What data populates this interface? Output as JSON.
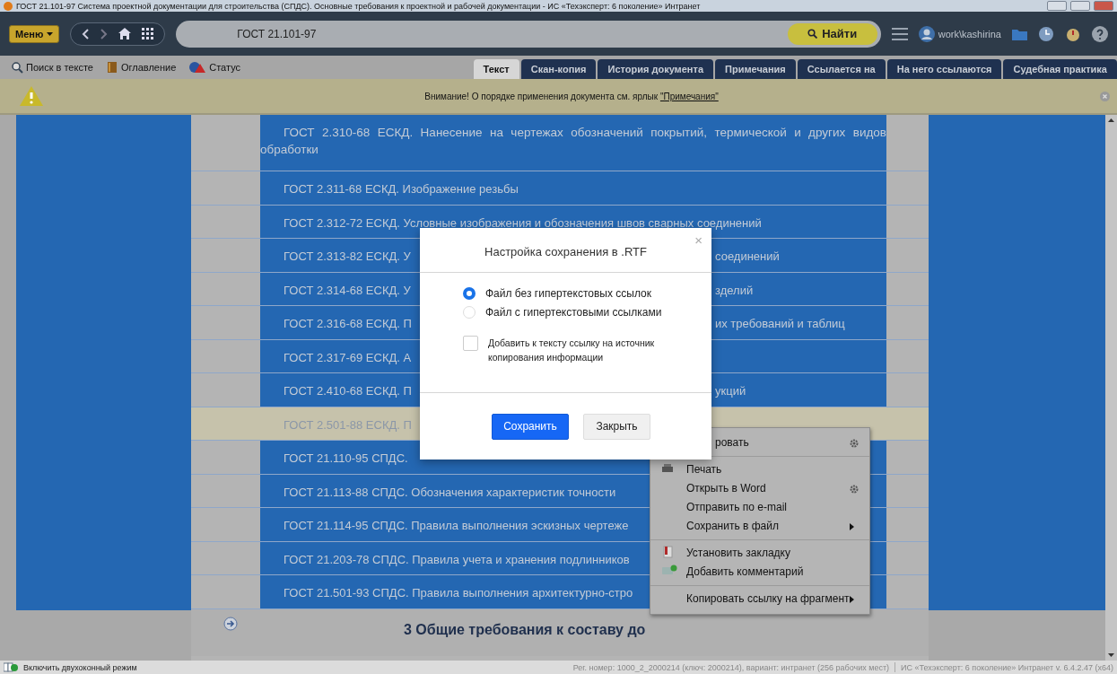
{
  "window": {
    "title": "ГОСТ 21.101-97 Система проектной документации для строительства (СПДС). Основные требования к проектной и рабочей документации - ИС «Техэксперт: 6 поколение» Интранет"
  },
  "toolbar": {
    "menu_button": "Меню",
    "search_value": "ГОСТ 21.101-97",
    "find_button": "Найти",
    "user": "work\\kashirina"
  },
  "secondary_toolbar": {
    "tools": [
      {
        "label": "Поиск в тексте"
      },
      {
        "label": "Оглавление"
      },
      {
        "label": "Статус"
      }
    ],
    "tabs": [
      {
        "label": "Текст",
        "selected": true
      },
      {
        "label": "Скан-копия",
        "selected": false
      },
      {
        "label": "История документа",
        "selected": false
      },
      {
        "label": "Примечания",
        "selected": false
      },
      {
        "label": "Ссылается на",
        "selected": false
      },
      {
        "label": "На него ссылаются",
        "selected": false
      },
      {
        "label": "Судебная практика",
        "selected": false
      }
    ]
  },
  "notice": {
    "text": "Внимание! О порядке применения документа см. ярлык ",
    "link": "\"Примечания\""
  },
  "document": {
    "rows": [
      {
        "text": "ГОСТ 2.310-68 ЕСКД. Нанесение на чертежах обозначений покрытий, термической и других видов обработки",
        "selected": false
      },
      {
        "text": "ГОСТ 2.311-68 ЕСКД. Изображение резьбы",
        "selected": false
      },
      {
        "text": "ГОСТ 2.312-72 ЕСКД. Условные изображения и обозначения швов сварных соединений",
        "selected": false
      },
      {
        "text": "ГОСТ 2.313-82 ЕСКД. У",
        "text_right": "соединений",
        "selected": false
      },
      {
        "text": "ГОСТ 2.314-68 ЕСКД. У",
        "text_right": "зделий",
        "selected": false
      },
      {
        "text": "ГОСТ 2.316-68 ЕСКД. П",
        "text_right": "их требований и таблиц",
        "selected": false
      },
      {
        "text": "ГОСТ 2.317-69 ЕСКД. А",
        "selected": false
      },
      {
        "text": "ГОСТ 2.410-68 ЕСКД. П",
        "text_right": "укций",
        "selected": false
      },
      {
        "text": "ГОСТ 2.501-88 ЕСКД. П",
        "selected": true
      },
      {
        "text": "ГОСТ 21.110-95 СПДС.",
        "selected": false
      },
      {
        "text": "ГОСТ 21.113-88 СПДС. Обозначения характеристик точности",
        "selected": false
      },
      {
        "text": "ГОСТ 21.114-95 СПДС. Правила выполнения эскизных чертеже",
        "selected": false
      },
      {
        "text": "ГОСТ 21.203-78 СПДС. Правила учета и хранения подлинников",
        "selected": false
      },
      {
        "text": "ГОСТ 21.501-93 СПДС. Правила выполнения архитектурно-стро",
        "selected": false
      }
    ],
    "section_heading": "3 Общие требования к составу до"
  },
  "context_menu": {
    "groups": [
      [
        {
          "label": "ровать"
        }
      ],
      [
        {
          "label": "Печать"
        },
        {
          "label": "Открыть в Word"
        },
        {
          "label": "Отправить по e-mail"
        },
        {
          "label": "Сохранить в файл"
        }
      ],
      [
        {
          "label": "Установить закладку"
        },
        {
          "label": "Добавить комментарий"
        }
      ],
      [
        {
          "label": "Копировать ссылку на фрагмент"
        }
      ]
    ]
  },
  "dialog": {
    "title": "Настройка сохранения в .RTF",
    "close": "×",
    "options": [
      {
        "label": "Файл без гипертекстовых ссылок",
        "selected": true
      },
      {
        "label": "Файл с гипертекстовыми ссылками",
        "selected": false
      }
    ],
    "checkbox": {
      "label": "Добавить к тексту ссылку на источник копирования информации",
      "checked": false
    },
    "buttons": [
      {
        "label": "Сохранить",
        "kind": "primary"
      },
      {
        "label": "Закрыть",
        "kind": "secondary"
      }
    ]
  },
  "status_bar": {
    "toggle": "Включить двухоконный режим",
    "registration": "Рег. номер: 1000_2_2000214 (ключ: 2000214), вариант: интранет (256 рабочих мест)",
    "version": "ИС «Техэксперт: 6 поколение» Интранет v. 6.4.2.47 (x64)"
  }
}
